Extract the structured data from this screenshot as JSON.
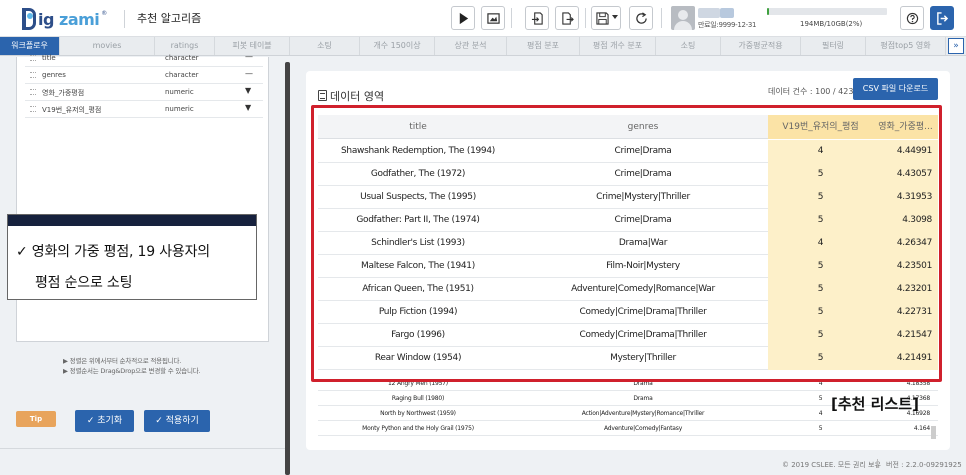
{
  "header": {
    "logo_text": "Big zami",
    "logo_mark": "®",
    "app_title": "추천 알고리즘",
    "toolbar_icons": [
      "play-icon",
      "image-icon",
      "import-icon",
      "export-icon",
      "save-icon",
      "caret-down-icon",
      "refresh-icon"
    ],
    "expire_label": "만료일:9999-12-31",
    "storage_text": "194MB/10GB(2%)",
    "storage_percent": 2,
    "accent_color": "#2b64ad",
    "storage_color": "#3fa13f"
  },
  "tabs": [
    "워크플로우",
    "movies",
    "ratings",
    "피봇 테이블",
    "소팅",
    "개수 150이상",
    "상관 분석",
    "평점 분포",
    "평점 개수 분포",
    "소팅",
    "가중평균적용",
    "필터링",
    "평점top5 영화"
  ],
  "active_tab": "워크플로우",
  "tab_more_label": "»",
  "variables": [
    {
      "name": "title",
      "type": "character",
      "control": "—"
    },
    {
      "name": "genres",
      "type": "character",
      "control": "—"
    },
    {
      "name": "영화_가중평점",
      "type": "numeric",
      "control": "▼"
    },
    {
      "name": "V19번_유저의_평점",
      "type": "numeric",
      "control": "▼"
    }
  ],
  "callout": {
    "line1": "✓ 영화의 가중 평점, 19 사용자의",
    "line2": "평점 순으로 소팅"
  },
  "tip": {
    "badge": "Tip",
    "line1": "▶ 정렬은 위에서부터 순차적으로 적용됩니다.",
    "line2": "▶ 정렬순서는 Drag&Drop으로 변경할 수 있습니다."
  },
  "left_buttons": {
    "reset": "✓  초기화",
    "apply": "✓  적용하기"
  },
  "data_panel": {
    "title": "데이터 영역",
    "count": "데이터 건수 : 100 / 423",
    "csv_button": "CSV 파일 다운로드",
    "columns": [
      "title",
      "genres",
      "V19번_유저의_평점",
      "영화_가중평..."
    ],
    "rows": [
      [
        "Shawshank Redemption, The (1994)",
        "Crime|Drama",
        "4",
        "4.44991"
      ],
      [
        "Godfather, The (1972)",
        "Crime|Drama",
        "5",
        "4.43057"
      ],
      [
        "Usual Suspects, The (1995)",
        "Crime|Mystery|Thriller",
        "5",
        "4.31953"
      ],
      [
        "Godfather: Part II, The (1974)",
        "Crime|Drama",
        "5",
        "4.3098"
      ],
      [
        "Schindler's List (1993)",
        "Drama|War",
        "4",
        "4.26347"
      ],
      [
        "Maltese Falcon, The (1941)",
        "Film-Noir|Mystery",
        "5",
        "4.23501"
      ],
      [
        "African Queen, The (1951)",
        "Adventure|Comedy|Romance|War",
        "5",
        "4.23201"
      ],
      [
        "Pulp Fiction (1994)",
        "Comedy|Crime|Drama|Thriller",
        "5",
        "4.22731"
      ],
      [
        "Fargo (1996)",
        "Comedy|Crime|Drama|Thriller",
        "5",
        "4.21547"
      ],
      [
        "Rear Window (1954)",
        "Mystery|Thriller",
        "5",
        "4.21491"
      ]
    ],
    "rows_small": [
      [
        "12 Angry Men (1957)",
        "Drama",
        "4",
        "4.18358"
      ],
      [
        "Raging Bull (1980)",
        "Drama",
        "5",
        "4.17368"
      ],
      [
        "North by Northwest (1959)",
        "Action|Adventure|Mystery|Romance|Thriller",
        "4",
        "4.16928"
      ],
      [
        "Monty Python and the Holy Grail (1975)",
        "Adventure|Comedy|Fantasy",
        "5",
        "4.164"
      ]
    ],
    "highlight_color": "#fdf0c9",
    "annotation_color": "#d0202c",
    "annotation_label": "[추천 리스트]"
  },
  "footer": {
    "copyright": "© 2019 CSLEE. 모든 권리 보유",
    "version": "버전 : 2.2.0-09291925"
  }
}
